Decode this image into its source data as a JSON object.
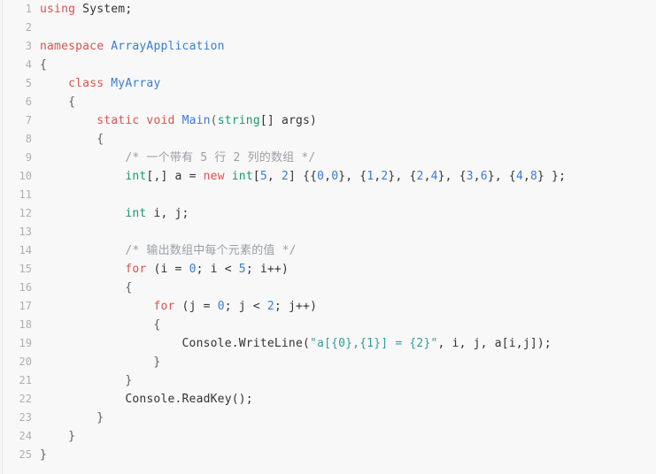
{
  "editor": {
    "language": "csharp",
    "background_color": "#f8f8f8",
    "gutter_color": "#afafaf",
    "default_text_color": "#333333",
    "total_lines": 25,
    "colors": {
      "keyword": "#d9534f",
      "type": "#1a9a72",
      "class_name": "#3a7bd5",
      "number": "#3a7bd5",
      "string": "#2aa198",
      "comment": "#9aa0a6",
      "plain": "#333333"
    },
    "lines": [
      {
        "number": "1",
        "tokens": [
          {
            "t": "using",
            "c": "kw"
          },
          {
            "t": " System;",
            "c": "plain"
          }
        ]
      },
      {
        "number": "2",
        "tokens": [
          {
            "t": "",
            "c": "plain"
          }
        ]
      },
      {
        "number": "3",
        "tokens": [
          {
            "t": "namespace",
            "c": "kw"
          },
          {
            "t": " ",
            "c": "plain"
          },
          {
            "t": "ArrayApplication",
            "c": "cls"
          }
        ]
      },
      {
        "number": "4",
        "tokens": [
          {
            "t": "{",
            "c": "punct"
          }
        ]
      },
      {
        "number": "5",
        "tokens": [
          {
            "t": "    ",
            "c": "plain"
          },
          {
            "t": "class",
            "c": "kw"
          },
          {
            "t": " ",
            "c": "plain"
          },
          {
            "t": "MyArray",
            "c": "cls"
          }
        ]
      },
      {
        "number": "6",
        "tokens": [
          {
            "t": "    {",
            "c": "punct"
          }
        ]
      },
      {
        "number": "7",
        "tokens": [
          {
            "t": "        ",
            "c": "plain"
          },
          {
            "t": "static",
            "c": "kw"
          },
          {
            "t": " ",
            "c": "plain"
          },
          {
            "t": "void",
            "c": "kw"
          },
          {
            "t": " ",
            "c": "plain"
          },
          {
            "t": "Main",
            "c": "cls"
          },
          {
            "t": "(",
            "c": "punct"
          },
          {
            "t": "string",
            "c": "type"
          },
          {
            "t": "[] args)",
            "c": "plain"
          }
        ]
      },
      {
        "number": "8",
        "tokens": [
          {
            "t": "        {",
            "c": "punct"
          }
        ]
      },
      {
        "number": "9",
        "tokens": [
          {
            "t": "            ",
            "c": "plain"
          },
          {
            "t": "/* 一个带有 5 行 2 列的数组 */",
            "c": "com"
          }
        ]
      },
      {
        "number": "10",
        "tokens": [
          {
            "t": "            ",
            "c": "plain"
          },
          {
            "t": "int",
            "c": "type"
          },
          {
            "t": "[,] a = ",
            "c": "plain"
          },
          {
            "t": "new",
            "c": "kw"
          },
          {
            "t": " ",
            "c": "plain"
          },
          {
            "t": "int",
            "c": "type"
          },
          {
            "t": "[",
            "c": "plain"
          },
          {
            "t": "5",
            "c": "num"
          },
          {
            "t": ", ",
            "c": "plain"
          },
          {
            "t": "2",
            "c": "num"
          },
          {
            "t": "] {{",
            "c": "plain"
          },
          {
            "t": "0",
            "c": "num"
          },
          {
            "t": ",",
            "c": "plain"
          },
          {
            "t": "0",
            "c": "num"
          },
          {
            "t": "}, {",
            "c": "plain"
          },
          {
            "t": "1",
            "c": "num"
          },
          {
            "t": ",",
            "c": "plain"
          },
          {
            "t": "2",
            "c": "num"
          },
          {
            "t": "}, {",
            "c": "plain"
          },
          {
            "t": "2",
            "c": "num"
          },
          {
            "t": ",",
            "c": "plain"
          },
          {
            "t": "4",
            "c": "num"
          },
          {
            "t": "}, {",
            "c": "plain"
          },
          {
            "t": "3",
            "c": "num"
          },
          {
            "t": ",",
            "c": "plain"
          },
          {
            "t": "6",
            "c": "num"
          },
          {
            "t": "}, {",
            "c": "plain"
          },
          {
            "t": "4",
            "c": "num"
          },
          {
            "t": ",",
            "c": "plain"
          },
          {
            "t": "8",
            "c": "num"
          },
          {
            "t": "} };",
            "c": "plain"
          }
        ]
      },
      {
        "number": "11",
        "tokens": [
          {
            "t": "",
            "c": "plain"
          }
        ]
      },
      {
        "number": "12",
        "tokens": [
          {
            "t": "            ",
            "c": "plain"
          },
          {
            "t": "int",
            "c": "type"
          },
          {
            "t": " i, j;",
            "c": "plain"
          }
        ]
      },
      {
        "number": "13",
        "tokens": [
          {
            "t": "",
            "c": "plain"
          }
        ]
      },
      {
        "number": "14",
        "tokens": [
          {
            "t": "            ",
            "c": "plain"
          },
          {
            "t": "/* 输出数组中每个元素的值 */",
            "c": "com"
          }
        ]
      },
      {
        "number": "15",
        "tokens": [
          {
            "t": "            ",
            "c": "plain"
          },
          {
            "t": "for",
            "c": "kw"
          },
          {
            "t": " (i = ",
            "c": "plain"
          },
          {
            "t": "0",
            "c": "num"
          },
          {
            "t": "; i < ",
            "c": "plain"
          },
          {
            "t": "5",
            "c": "num"
          },
          {
            "t": "; i++)",
            "c": "plain"
          }
        ]
      },
      {
        "number": "16",
        "tokens": [
          {
            "t": "            {",
            "c": "punct"
          }
        ]
      },
      {
        "number": "17",
        "tokens": [
          {
            "t": "                ",
            "c": "plain"
          },
          {
            "t": "for",
            "c": "kw"
          },
          {
            "t": " (j = ",
            "c": "plain"
          },
          {
            "t": "0",
            "c": "num"
          },
          {
            "t": "; j < ",
            "c": "plain"
          },
          {
            "t": "2",
            "c": "num"
          },
          {
            "t": "; j++)",
            "c": "plain"
          }
        ]
      },
      {
        "number": "18",
        "tokens": [
          {
            "t": "                {",
            "c": "punct"
          }
        ]
      },
      {
        "number": "19",
        "tokens": [
          {
            "t": "                    Console.WriteLine(",
            "c": "plain"
          },
          {
            "t": "\"a[{0},{1}] = {2}\"",
            "c": "str"
          },
          {
            "t": ", i, j, a[i,j]);",
            "c": "plain"
          }
        ]
      },
      {
        "number": "20",
        "tokens": [
          {
            "t": "                }",
            "c": "punct"
          }
        ]
      },
      {
        "number": "21",
        "tokens": [
          {
            "t": "            }",
            "c": "punct"
          }
        ]
      },
      {
        "number": "22",
        "tokens": [
          {
            "t": "            Console.ReadKey();",
            "c": "plain"
          }
        ]
      },
      {
        "number": "23",
        "tokens": [
          {
            "t": "        }",
            "c": "punct"
          }
        ]
      },
      {
        "number": "24",
        "tokens": [
          {
            "t": "    }",
            "c": "punct"
          }
        ]
      },
      {
        "number": "25",
        "tokens": [
          {
            "t": "}",
            "c": "punct"
          }
        ]
      }
    ]
  }
}
